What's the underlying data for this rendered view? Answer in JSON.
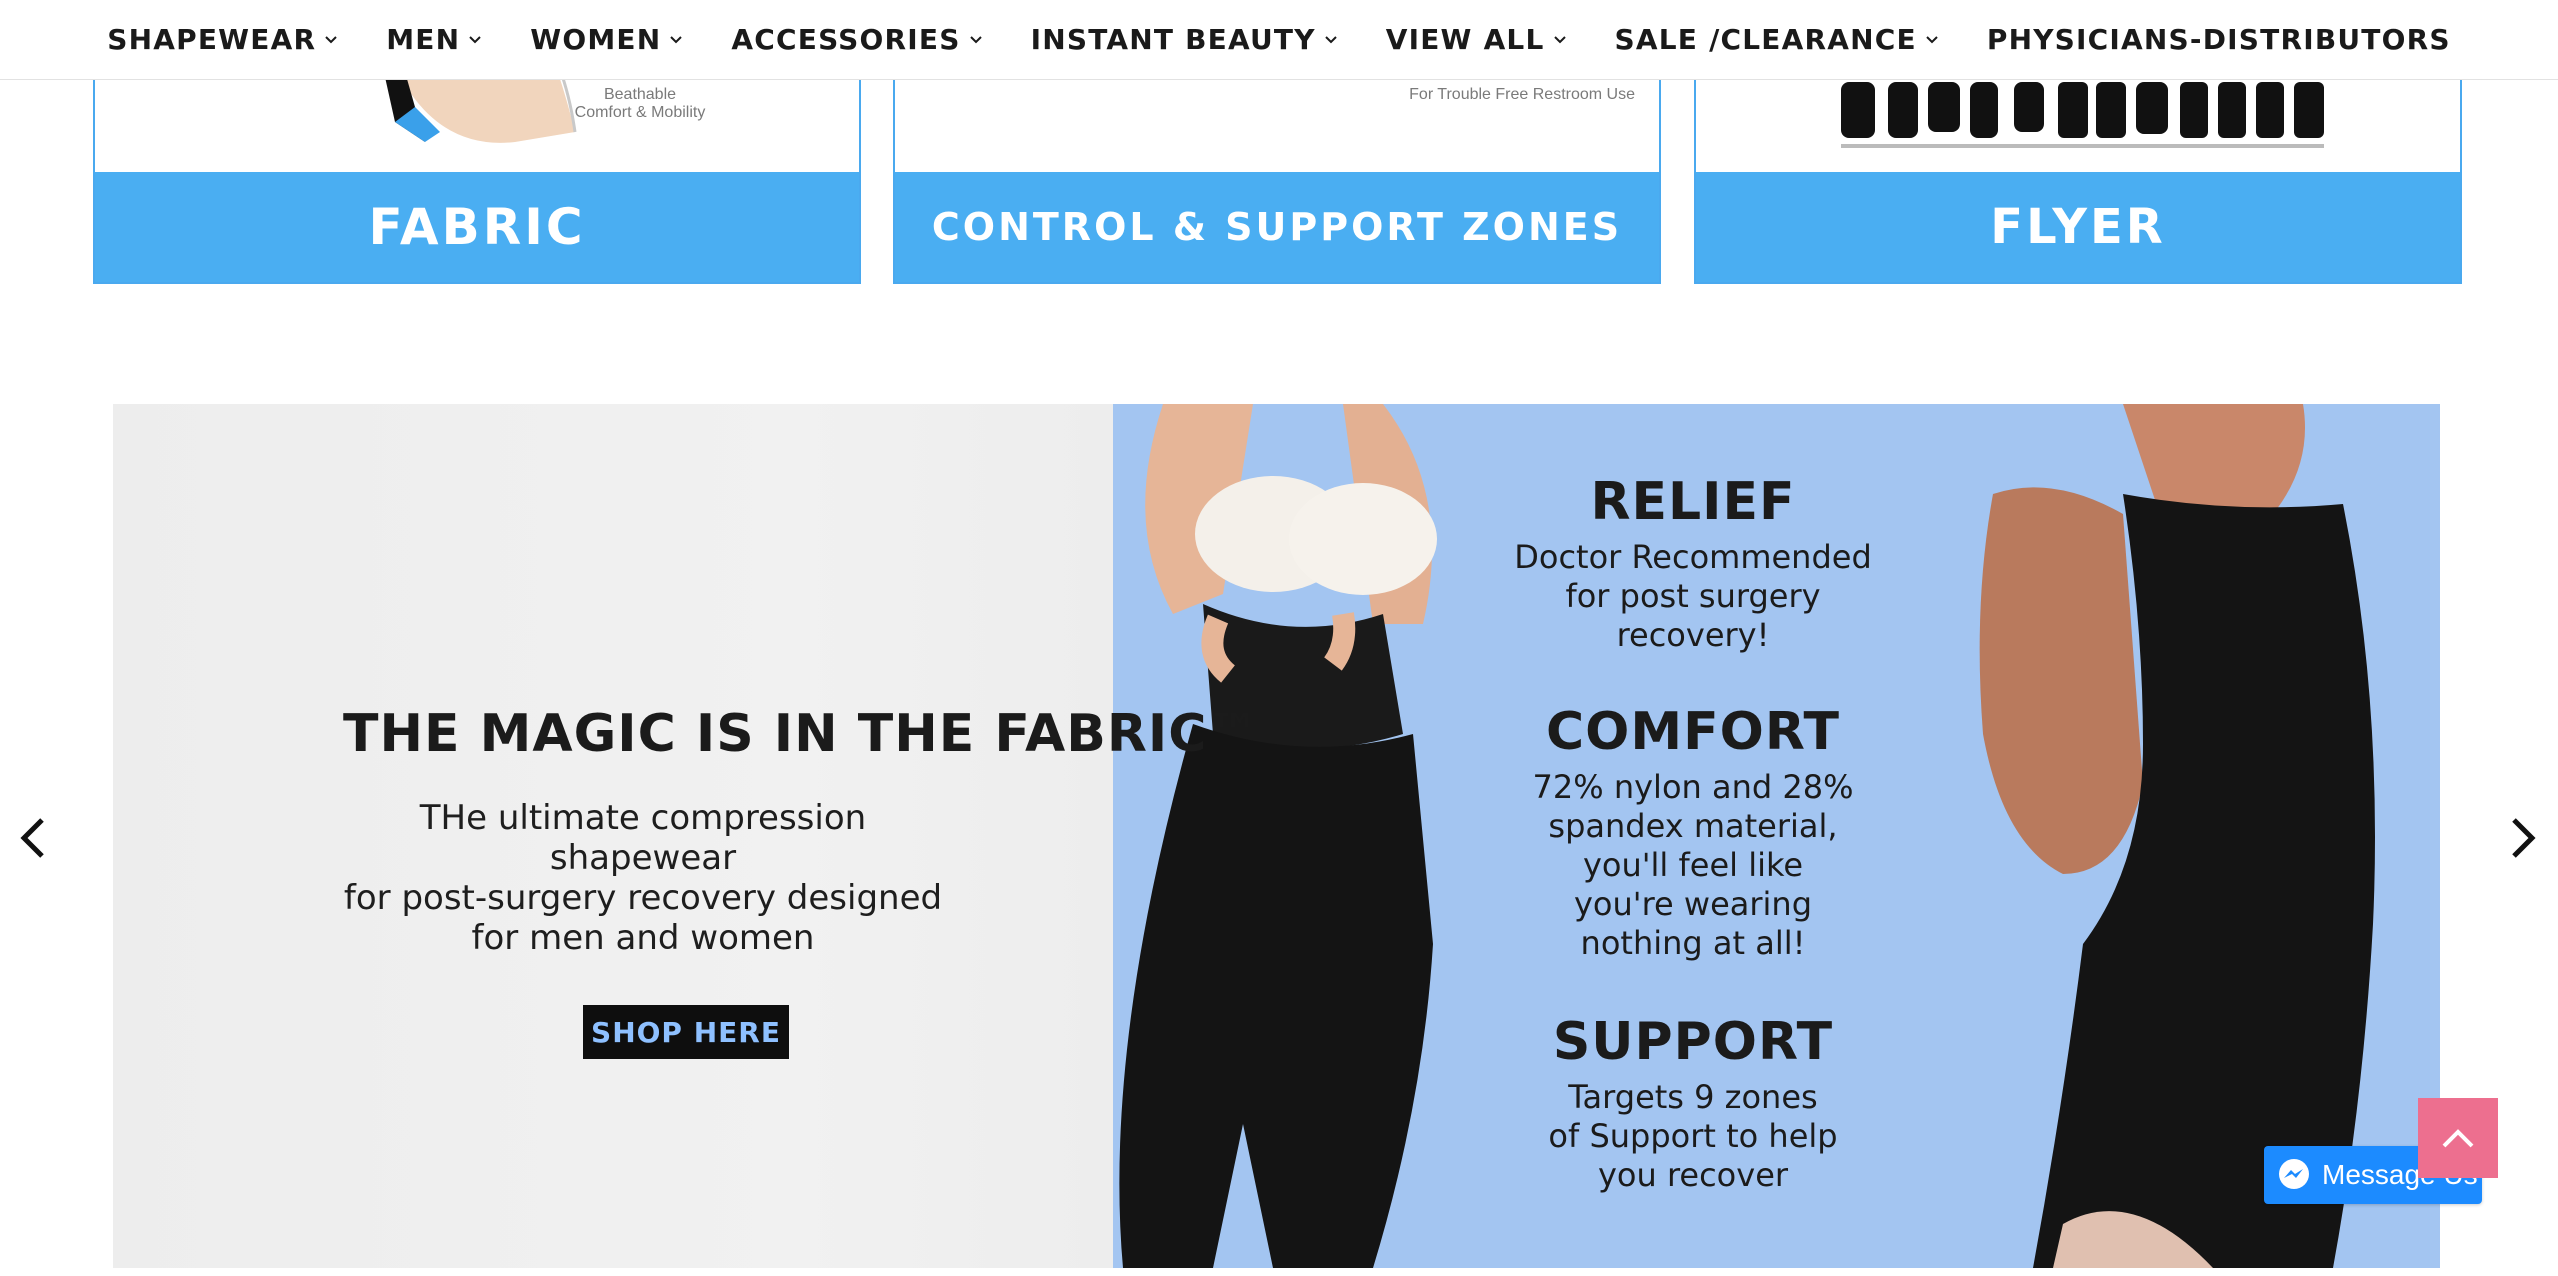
{
  "nav": {
    "items": [
      {
        "label": "SHAPEWEAR",
        "has_dropdown": true
      },
      {
        "label": "MEN",
        "has_dropdown": true
      },
      {
        "label": "WOMEN",
        "has_dropdown": true
      },
      {
        "label": "ACCESSORIES",
        "has_dropdown": true
      },
      {
        "label": "INSTANT BEAUTY",
        "has_dropdown": true
      },
      {
        "label": "VIEW ALL",
        "has_dropdown": true
      },
      {
        "label": "SALE /CLEARANCE",
        "has_dropdown": true
      },
      {
        "label": "PHYSICIANS-DISTRIBUTORS",
        "has_dropdown": false
      }
    ]
  },
  "cards": {
    "fabric": {
      "label": "FABRIC",
      "caption": "Beathable\nComfort & Mobility"
    },
    "zones": {
      "label": "CONTROL & SUPPORT ZONES",
      "caption": "For Trouble Free Restroom Use"
    },
    "flyer": {
      "label": "FLYER"
    }
  },
  "banner": {
    "headline": "THE MAGIC IS IN THE FABRIC™",
    "subcopy_1": "THe ultimate compression shapewear",
    "subcopy_2": "for post-surgery recovery designed",
    "subcopy_3": "for men and women",
    "cta": "SHOP HERE",
    "features": [
      {
        "title": "RELIEF",
        "lines": [
          "Doctor Recommended",
          "for post surgery",
          "recovery!"
        ]
      },
      {
        "title": "COMFORT",
        "lines": [
          "72% nylon and 28%",
          "spandex material,",
          "you'll feel like",
          "you're wearing",
          "nothing at all!"
        ]
      },
      {
        "title": "SUPPORT",
        "lines": [
          "Targets 9 zones",
          "of Support to help",
          "you recover"
        ]
      }
    ]
  },
  "widgets": {
    "messenger_label": "Message Us"
  },
  "colors": {
    "card_band": "#4aaef2",
    "banner_right_bg": "#a3c5f1",
    "back_to_top": "#ed6f8f",
    "messenger": "#1c8bff"
  }
}
